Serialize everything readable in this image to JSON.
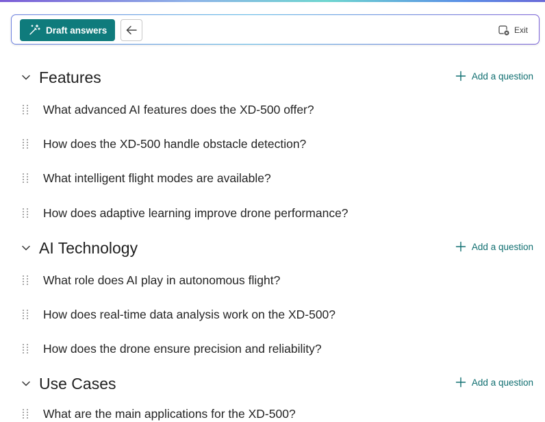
{
  "toolbar": {
    "draft_label": "Draft answers",
    "exit_label": "Exit"
  },
  "sections": [
    {
      "title": "Features",
      "add_label": "Add a question",
      "questions": [
        "What advanced AI features does the XD-500 offer?",
        "How does the XD-500 handle obstacle detection?",
        "What intelligent flight modes are available?",
        "How does adaptive learning improve drone performance?"
      ]
    },
    {
      "title": "AI Technology",
      "add_label": "Add a question",
      "questions": [
        "What role does AI play in autonomous flight?",
        "How does real-time data analysis work on the XD-500?",
        "How does the drone ensure precision and reliability?"
      ]
    },
    {
      "title": "Use Cases",
      "add_label": "Add a question",
      "questions": [
        "What are the main applications for the XD-500?"
      ]
    }
  ],
  "colors": {
    "accent": "#0f7b7c",
    "link": "#0f6e70"
  }
}
